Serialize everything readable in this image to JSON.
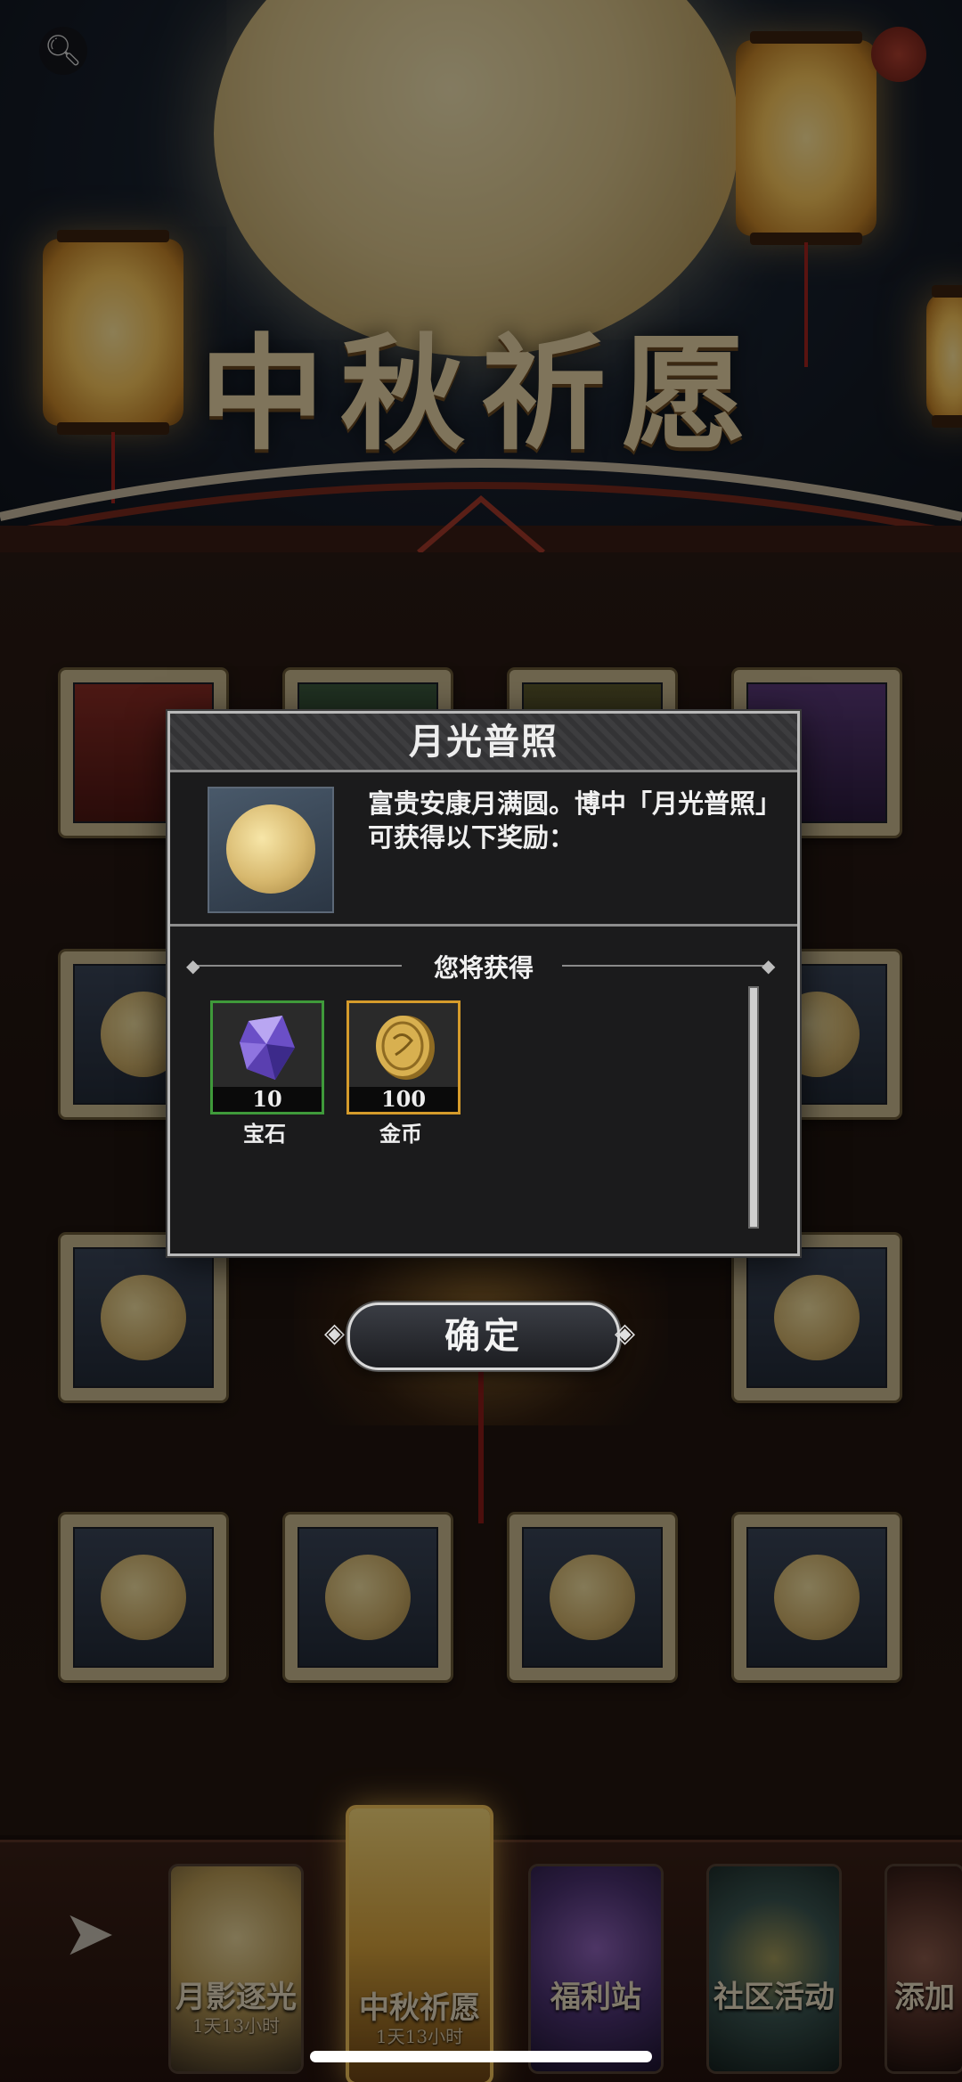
{
  "banner": {
    "title": "中秋祈愿"
  },
  "dialog": {
    "title": "月光普照",
    "description": "富贵安康月满圆。博中「月光普照」可获得以下奖励：",
    "section_label": "您将获得",
    "rewards": [
      {
        "name": "宝石",
        "qty": "10",
        "rarity": "green",
        "icon": "gem-icon"
      },
      {
        "name": "金币",
        "qty": "100",
        "rarity": "gold",
        "icon": "gold-coin-icon"
      }
    ],
    "confirm_label": "确定"
  },
  "bottom_nav": {
    "items": [
      {
        "label": "月影逐光",
        "sub": "1天13小时"
      },
      {
        "label": "中秋祈愿",
        "sub": "1天13小时",
        "active": true
      },
      {
        "label": "福利站",
        "sub": ""
      },
      {
        "label": "社区活动",
        "sub": ""
      },
      {
        "label": "添加",
        "sub": ""
      }
    ]
  },
  "colors": {
    "reward_green": "#3f9a3a",
    "reward_gold": "#d59b2b",
    "active_tab_glow": "#f1c15a"
  }
}
